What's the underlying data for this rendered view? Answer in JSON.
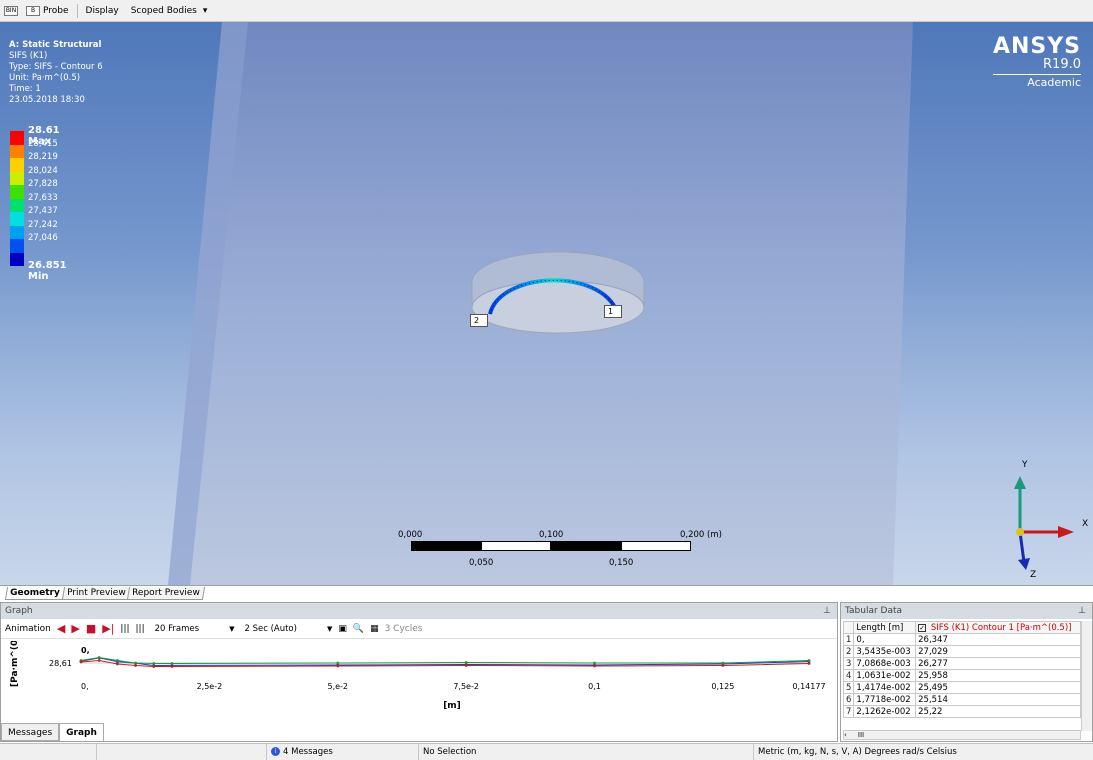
{
  "toolbar": {
    "min_label": "BIN",
    "probe_icon": "B",
    "probe_label": "Probe",
    "display_label": "Display",
    "scoped_value": "Scoped Bodies"
  },
  "result_header": {
    "title": "A: Static Structural",
    "lines": [
      "SIFS (K1)",
      "Type: SIFS - Contour 6",
      "Unit: Pa·m^(0.5)",
      "Time: 1",
      "23.05.2018 18:30"
    ]
  },
  "legend": {
    "max_label": "28.61 Max",
    "labels": [
      "28,415",
      "28,219",
      "28,024",
      "27,828",
      "27,633",
      "27,437",
      "27,242",
      "27,046"
    ],
    "min_label": "26.851 Min",
    "colors": [
      "#ff0000",
      "#ff8000",
      "#ffd000",
      "#c8f000",
      "#40e000",
      "#00e070",
      "#00e0e0",
      "#00a0f0",
      "#0050f0",
      "#0000c0"
    ]
  },
  "brand": {
    "name": "ANSYS",
    "version": "R19.0",
    "edition": "Academic"
  },
  "scale_bar": {
    "top": [
      "0,000",
      "0,100",
      "0,200 (m)"
    ],
    "bottom": [
      "0,050",
      "0,150"
    ]
  },
  "probes": [
    "2",
    "1"
  ],
  "triad": {
    "x": "X",
    "y": "Y",
    "z": "Z"
  },
  "view_tabs": [
    "Geometry",
    "Print Preview",
    "Report Preview"
  ],
  "graph": {
    "title": "Graph",
    "animation_label": "Animation",
    "frames": "20 Frames",
    "duration": "2 Sec (Auto)",
    "cycles": "3 Cycles",
    "ylabel": "[Pa·m^(0.5",
    "ytick_top": "0,",
    "ytick_value": "28,61",
    "xlabel": "[m]",
    "xticks": [
      "0,",
      "2,5e-2",
      "5,e-2",
      "7,5e-2",
      "0,1",
      "0,125",
      "0,14177"
    ],
    "tabs": [
      "Messages",
      "Graph"
    ]
  },
  "chart_data": {
    "type": "line",
    "xlabel": "[m]",
    "ylabel": "[Pa·m^(0.5",
    "xlim": [
      0,
      0.14177
    ],
    "series": [
      {
        "color": "#1a3fd0",
        "x": [
          0,
          0.0035435,
          0.0070868,
          0.010631,
          0.014174,
          0.017718,
          0.05,
          0.075,
          0.1,
          0.125,
          0.14177
        ],
        "y": [
          26.347,
          27.029,
          26.277,
          25.958,
          25.495,
          25.514,
          25.6,
          25.7,
          25.6,
          25.8,
          26.3
        ]
      },
      {
        "color": "#1a9a3a",
        "x": [
          0,
          0.0035435,
          0.0070868,
          0.010631,
          0.014174,
          0.017718,
          0.05,
          0.075,
          0.1,
          0.125,
          0.14177
        ],
        "y": [
          26.5,
          27.1,
          26.5,
          26.0,
          25.9,
          25.9,
          26.0,
          26.1,
          26.0,
          26.0,
          26.5
        ]
      },
      {
        "color": "#d01a1a",
        "x": [
          0,
          0.0035435,
          0.0070868,
          0.010631,
          0.014174,
          0.017718,
          0.05,
          0.075,
          0.1,
          0.125,
          0.14177
        ],
        "y": [
          26.2,
          26.5,
          25.8,
          25.5,
          25.3,
          25.3,
          25.4,
          25.5,
          25.4,
          25.5,
          25.9
        ]
      }
    ]
  },
  "tabular": {
    "title": "Tabular Data",
    "col_length": "Length [m]",
    "col_sifs": "SIFS (K1) Contour 1 [Pa·m^(0.5)]",
    "rows": [
      {
        "i": "1",
        "len": "0,",
        "val": "26,347"
      },
      {
        "i": "2",
        "len": "3,5435e-003",
        "val": "27,029"
      },
      {
        "i": "3",
        "len": "7,0868e-003",
        "val": "26,277"
      },
      {
        "i": "4",
        "len": "1,0631e-002",
        "val": "25,958"
      },
      {
        "i": "5",
        "len": "1,4174e-002",
        "val": "25,495"
      },
      {
        "i": "6",
        "len": "1,7718e-002",
        "val": "25,514"
      },
      {
        "i": "7",
        "len": "2,1262e-002",
        "val": "25,22"
      }
    ]
  },
  "status": {
    "messages": "4 Messages",
    "selection": "No Selection",
    "units": "Metric (m, kg, N, s, V, A)  Degrees  rad/s  Celsius"
  }
}
